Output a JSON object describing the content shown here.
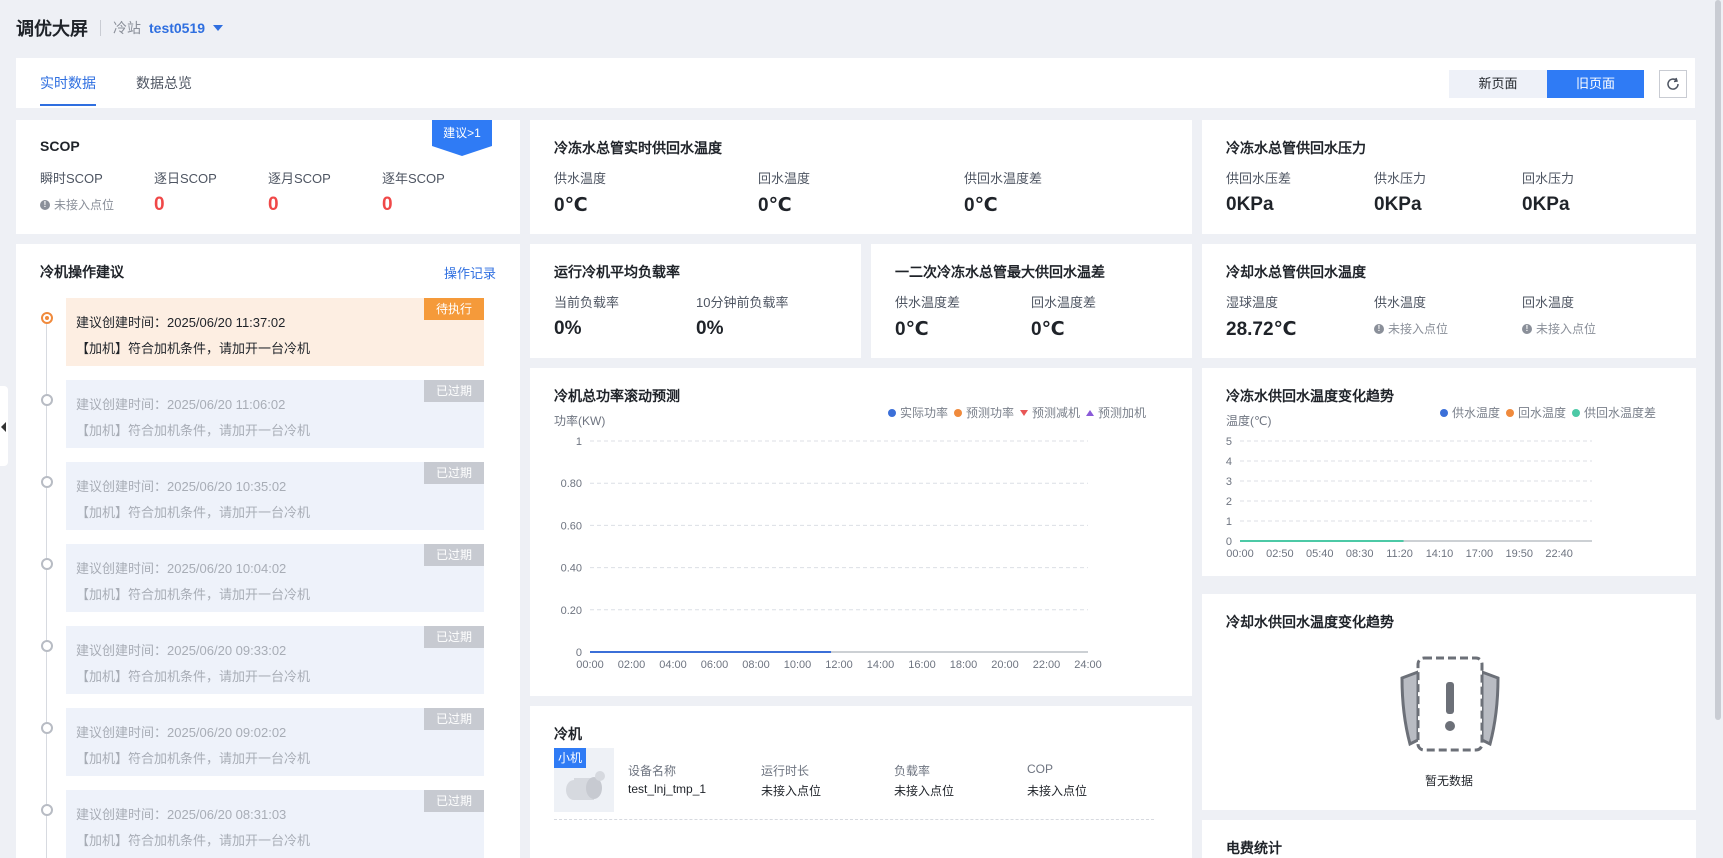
{
  "header": {
    "title": "调优大屏",
    "station_label": "冷站",
    "station_name": "test0519"
  },
  "tabs": {
    "realtime": "实时数据",
    "overview": "数据总览"
  },
  "buttons": {
    "new_page": "新页面",
    "old_page": "旧页面"
  },
  "colors": {
    "accent": "#2f7bf5",
    "alert_red": "#f04848",
    "pending_orange": "#f59a3a",
    "expired_grey": "#c7cad1"
  },
  "scop": {
    "title": "SCOP",
    "suggest_badge": "建议>1",
    "labels": [
      "瞬时SCOP",
      "逐日SCOP",
      "逐月SCOP",
      "逐年SCOP"
    ],
    "instant_status": "未接入点位",
    "daily": "0",
    "monthly": "0",
    "yearly": "0"
  },
  "chw_supply_return_temp": {
    "title": "冷冻水总管实时供回水温度",
    "labels": [
      "供水温度",
      "回水温度",
      "供回水温度差"
    ],
    "values": [
      "0℃",
      "0℃",
      "0℃"
    ]
  },
  "chw_pressure": {
    "title": "冷冻水总管供回水压力",
    "labels": [
      "供回水压差",
      "供水压力",
      "回水压力"
    ],
    "values": [
      "0KPa",
      "0KPa",
      "0KPa"
    ]
  },
  "suggestions": {
    "title": "冷机操作建议",
    "record_link": "操作记录",
    "items": [
      {
        "time": "建议创建时间：2025/06/20 11:37:02",
        "text": "【加机】符合加机条件，请加开一台冷机",
        "status": "待执行"
      },
      {
        "time": "建议创建时间：2025/06/20 11:06:02",
        "text": "【加机】符合加机条件，请加开一台冷机",
        "status": "已过期"
      },
      {
        "time": "建议创建时间：2025/06/20 10:35:02",
        "text": "【加机】符合加机条件，请加开一台冷机",
        "status": "已过期"
      },
      {
        "time": "建议创建时间：2025/06/20 10:04:02",
        "text": "【加机】符合加机条件，请加开一台冷机",
        "status": "已过期"
      },
      {
        "time": "建议创建时间：2025/06/20 09:33:02",
        "text": "【加机】符合加机条件，请加开一台冷机",
        "status": "已过期"
      },
      {
        "time": "建议创建时间：2025/06/20 09:02:02",
        "text": "【加机】符合加机条件，请加开一台冷机",
        "status": "已过期"
      },
      {
        "time": "建议创建时间：2025/06/20 08:31:03",
        "text": "【加机】符合加机条件，请加开一台冷机",
        "status": "已过期"
      }
    ]
  },
  "load_rate": {
    "title": "运行冷机平均负载率",
    "labels": [
      "当前负载率",
      "10分钟前负载率"
    ],
    "values": [
      "0%",
      "0%"
    ]
  },
  "secondary_temp_diff": {
    "title": "一二次冷冻水总管最大供回水温差",
    "labels": [
      "供水温度差",
      "回水温度差"
    ],
    "values": [
      "0℃",
      "0℃"
    ]
  },
  "cooling_water_temp": {
    "title": "冷却水总管供回水温度",
    "labels": [
      "湿球温度",
      "供水温度",
      "回水温度"
    ],
    "wet_bulb": "28.72℃",
    "supply_status": "未接入点位",
    "return_status": "未接入点位"
  },
  "power_chart": {
    "title": "冷机总功率滚动预测",
    "ylabel": "功率(KW)",
    "legend": [
      "实际功率",
      "预测功率",
      "预测减机",
      "预测加机"
    ],
    "legend_colors": [
      "#3b6fd8",
      "#f08a3c",
      "#e85656",
      "#8a5ad8"
    ],
    "chart_data": {
      "type": "line",
      "x": [
        "00:00",
        "02:00",
        "04:00",
        "06:00",
        "08:00",
        "10:00",
        "12:00",
        "14:00",
        "16:00",
        "18:00",
        "20:00",
        "22:00",
        "24:00"
      ],
      "yticks": [
        "0",
        "0.20",
        "0.40",
        "0.60",
        "0.80",
        "1"
      ],
      "ylim": [
        0,
        1
      ],
      "series": [
        {
          "name": "实际功率",
          "x": [
            "00:00",
            "11:37"
          ],
          "values": [
            0,
            0
          ]
        }
      ],
      "grid": true,
      "legend_position": "top-right"
    }
  },
  "chw_trend_chart": {
    "title": "冷冻水供回水温度变化趋势",
    "ylabel": "温度(℃)",
    "legend": [
      "供水温度",
      "回水温度",
      "供回水温度差"
    ],
    "legend_colors": [
      "#3b6fd8",
      "#f08a3c",
      "#4cc9a6"
    ],
    "chart_data": {
      "type": "line",
      "x": [
        "00:00",
        "02:50",
        "05:40",
        "08:30",
        "11:20",
        "14:10",
        "17:00",
        "19:50",
        "22:40"
      ],
      "yticks": [
        "0",
        "1",
        "2",
        "3",
        "4",
        "5"
      ],
      "ylim": [
        0,
        5
      ],
      "series": [
        {
          "name": "供回水温度差",
          "x": [
            "00:00",
            "11:37"
          ],
          "values": [
            0,
            0
          ]
        }
      ],
      "grid": true,
      "legend_position": "top-right"
    }
  },
  "cooling_trend": {
    "title": "冷却水供回水温度变化趋势",
    "empty_text": "暂无数据"
  },
  "chiller": {
    "title": "冷机",
    "tag": "小机",
    "labels": [
      "设备名称",
      "运行时长",
      "负载率",
      "COP"
    ],
    "name": "test_lnj_tmp_1",
    "runtime": "未接入点位",
    "load": "未接入点位",
    "cop": "未接入点位"
  },
  "electricity": {
    "title": "电费统计"
  }
}
